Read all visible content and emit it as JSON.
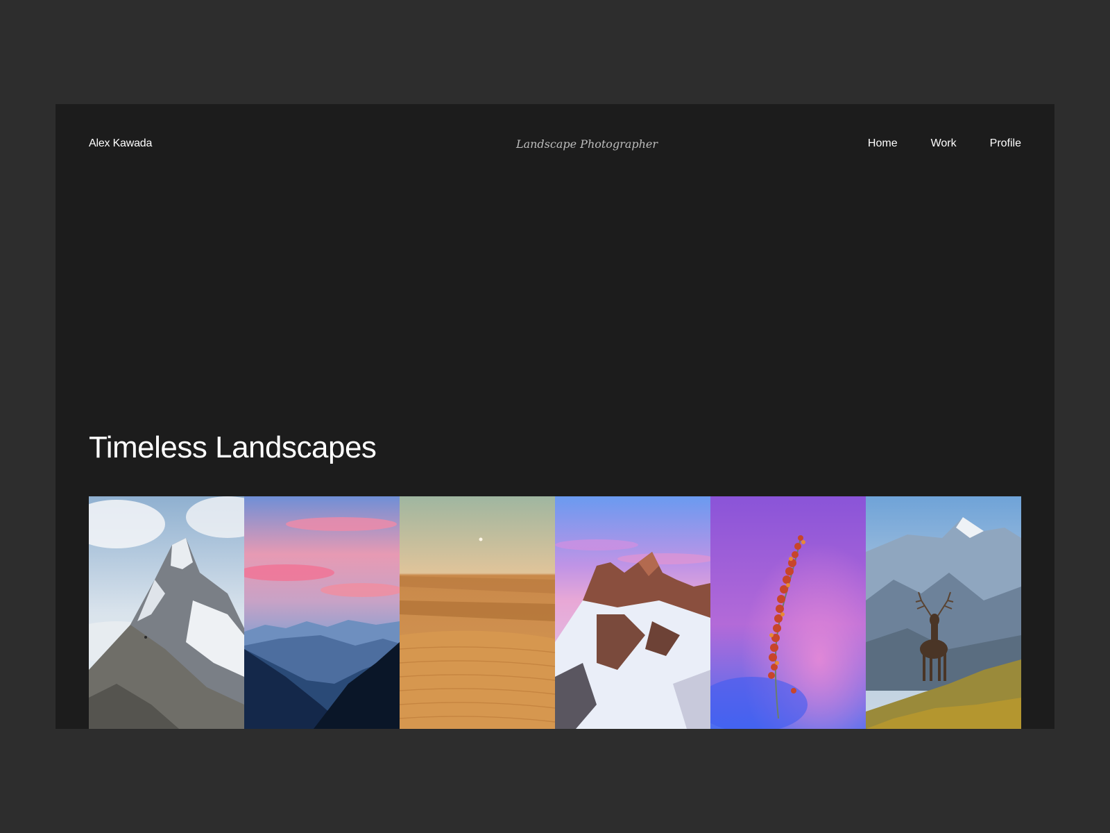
{
  "header": {
    "brand": "Alex Kawada",
    "tagline": "Landscape Photographer",
    "nav": [
      {
        "label": "Home"
      },
      {
        "label": "Work"
      },
      {
        "label": "Profile"
      }
    ]
  },
  "hero": {
    "title": "Timeless Landscapes"
  },
  "gallery": {
    "photos": [
      {
        "subject": "snowy-mountain-peak"
      },
      {
        "subject": "sunset-mountain-ranges"
      },
      {
        "subject": "desert-sand-dunes"
      },
      {
        "subject": "snowy-rocky-peaks-dusk"
      },
      {
        "subject": "flower-stem-purple"
      },
      {
        "subject": "deer-alpine-meadow"
      }
    ]
  },
  "colors": {
    "page_background": "#2d2d2d",
    "frame_background": "#1c1c1c",
    "text_primary": "#ffffff",
    "text_secondary": "#bdbdbd"
  }
}
